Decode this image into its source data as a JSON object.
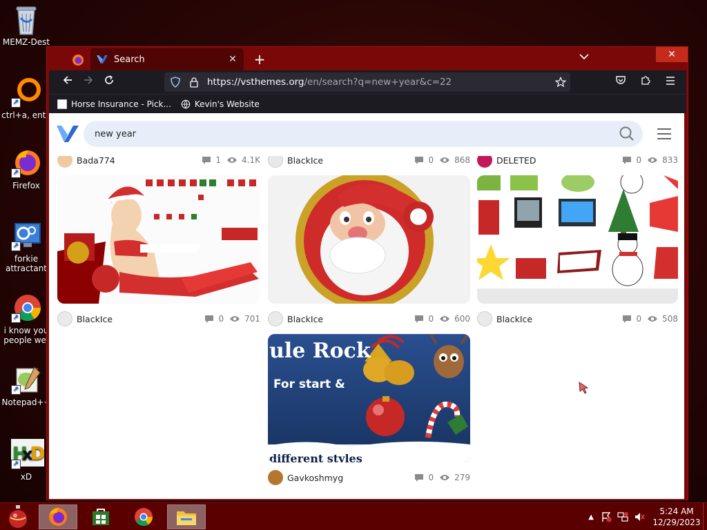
{
  "desktop": {
    "icons": [
      {
        "label": "MEMZ-Dest"
      },
      {
        "label": "ctrl+a, ente"
      },
      {
        "label": "Firefox"
      },
      {
        "label": "forkie attractant"
      },
      {
        "label": "i know you people we."
      },
      {
        "label": "Notepad++"
      },
      {
        "label": "xD"
      }
    ]
  },
  "browser": {
    "tab_title": "Search",
    "tab_close": "✕",
    "new_tab": "+",
    "tab_list": "⌄",
    "window_close": "✕",
    "url_host": "https://vsthemes.org",
    "url_path": "/en/search?q=new+year&c=22",
    "bookmarks": [
      {
        "label": "Horse Insurance - Pick..."
      },
      {
        "label": "Kevin's Website"
      }
    ]
  },
  "site": {
    "search_value": "new year",
    "cards": [
      {
        "author": "Bada774",
        "comments": "1",
        "views": "4.1K"
      },
      {
        "author": "BlackIce",
        "comments": "0",
        "views": "868"
      },
      {
        "author": "DELETED",
        "comments": "0",
        "views": "833"
      },
      {
        "author": "BlackIce",
        "comments": "0",
        "views": "701"
      },
      {
        "author": "BlackIce",
        "comments": "0",
        "views": "600"
      },
      {
        "author": "BlackIce",
        "comments": "0",
        "views": "508"
      },
      {
        "author": "Gavkoshmyg",
        "comments": "0",
        "views": "279"
      }
    ],
    "thumb5_text1": "ule Rock",
    "thumb5_text2": "For start &",
    "thumb5_text3": "different styles"
  },
  "taskbar": {
    "time": "5:24 AM",
    "date": "12/29/2023"
  },
  "colors": {
    "accent": "#c42b1c",
    "taskbar": "#5a0000",
    "window_frame": "#7a0808",
    "search_bg": "#e8eef9"
  }
}
